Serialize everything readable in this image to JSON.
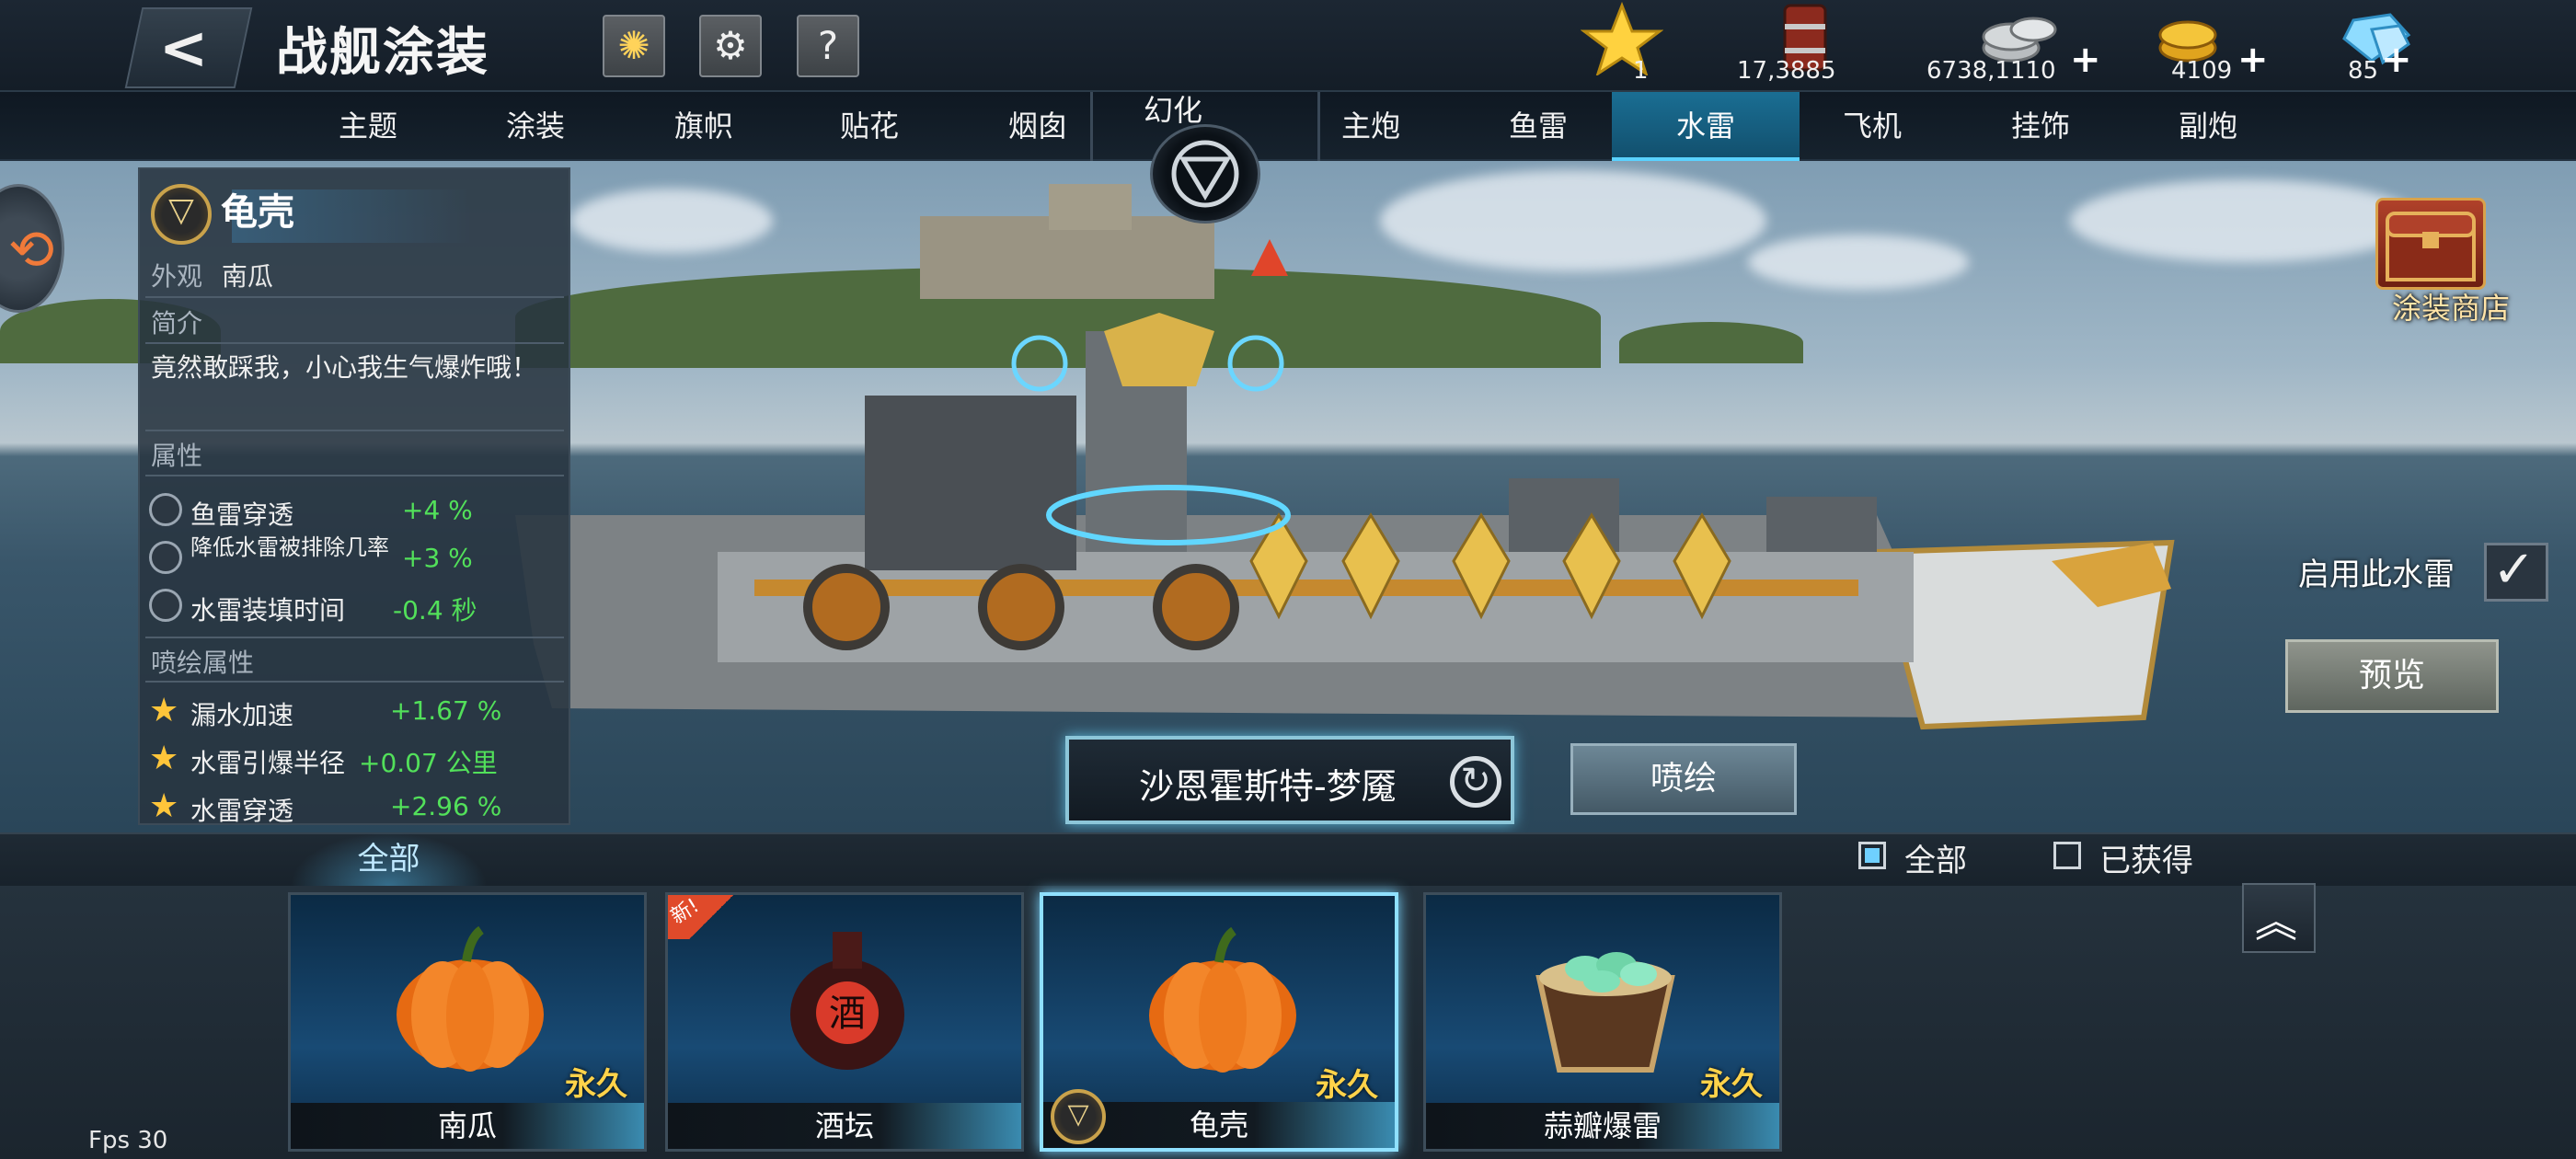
{
  "header": {
    "title": "战舰涂装",
    "resources": [
      {
        "icon": "star-icon",
        "value": "1",
        "plus": false
      },
      {
        "icon": "oil-barrel-icon",
        "value": "17,3885",
        "plus": false
      },
      {
        "icon": "silver-coins-icon",
        "value": "6738,1110",
        "plus": true
      },
      {
        "icon": "gold-coins-icon",
        "value": "4109",
        "plus": true
      },
      {
        "icon": "diamond-icon",
        "value": "85",
        "plus": true
      }
    ],
    "plus_symbol": "+"
  },
  "tabs_left": [
    "主题",
    "涂装",
    "旗帜",
    "贴花",
    "烟囱"
  ],
  "center_tab": "幻化",
  "tabs_right": [
    "主炮",
    "鱼雷",
    "水雷",
    "飞机",
    "挂饰",
    "副炮"
  ],
  "active_tab": "水雷",
  "info_panel": {
    "name": "龟壳",
    "appearance_label": "外观",
    "appearance_value": "南瓜",
    "intro_label": "简介",
    "intro_text": "竟然敢踩我，小心我生气爆炸哦！",
    "attr_label": "属性",
    "attributes": [
      {
        "name": "鱼雷穿透",
        "value": "+4 %"
      },
      {
        "name": "降低水雷被排除几率",
        "value": "+3 %"
      },
      {
        "name": "水雷装填时间",
        "value": "-0.4 秒"
      }
    ],
    "paint_attr_label": "喷绘属性",
    "paint_attributes": [
      {
        "name": "漏水加速",
        "value": "+1.67 %"
      },
      {
        "name": "水雷引爆半径",
        "value": "+0.07 公里"
      },
      {
        "name": "水雷穿透",
        "value": "+2.96 %"
      }
    ]
  },
  "ship_name": "沙恩霍斯特-梦魇",
  "spray_button": "喷绘",
  "preview_button": "预览",
  "enable_label": "启用此水雷",
  "shop_label": "涂装商店",
  "filter": {
    "tab": "全部",
    "options": [
      {
        "label": "全部",
        "checked": true
      },
      {
        "label": "已获得",
        "checked": false
      }
    ]
  },
  "items": [
    {
      "name": "南瓜",
      "duration": "永久",
      "icon": "pumpkin-icon",
      "is_new": false,
      "selected": false
    },
    {
      "name": "酒坛",
      "duration": "",
      "icon": "wine-jar-icon",
      "is_new": true,
      "selected": false
    },
    {
      "name": "龟壳",
      "duration": "永久",
      "icon": "pumpkin-icon",
      "is_new": false,
      "selected": true
    },
    {
      "name": "蒜瓣爆雷",
      "duration": "永久",
      "icon": "garlic-bowl-icon",
      "is_new": false,
      "selected": false
    }
  ],
  "new_tag": "新!",
  "fps": "Fps 30",
  "colors": {
    "accent": "#5ad2ff",
    "positive": "#52e05a",
    "gold": "#ffd24a"
  }
}
